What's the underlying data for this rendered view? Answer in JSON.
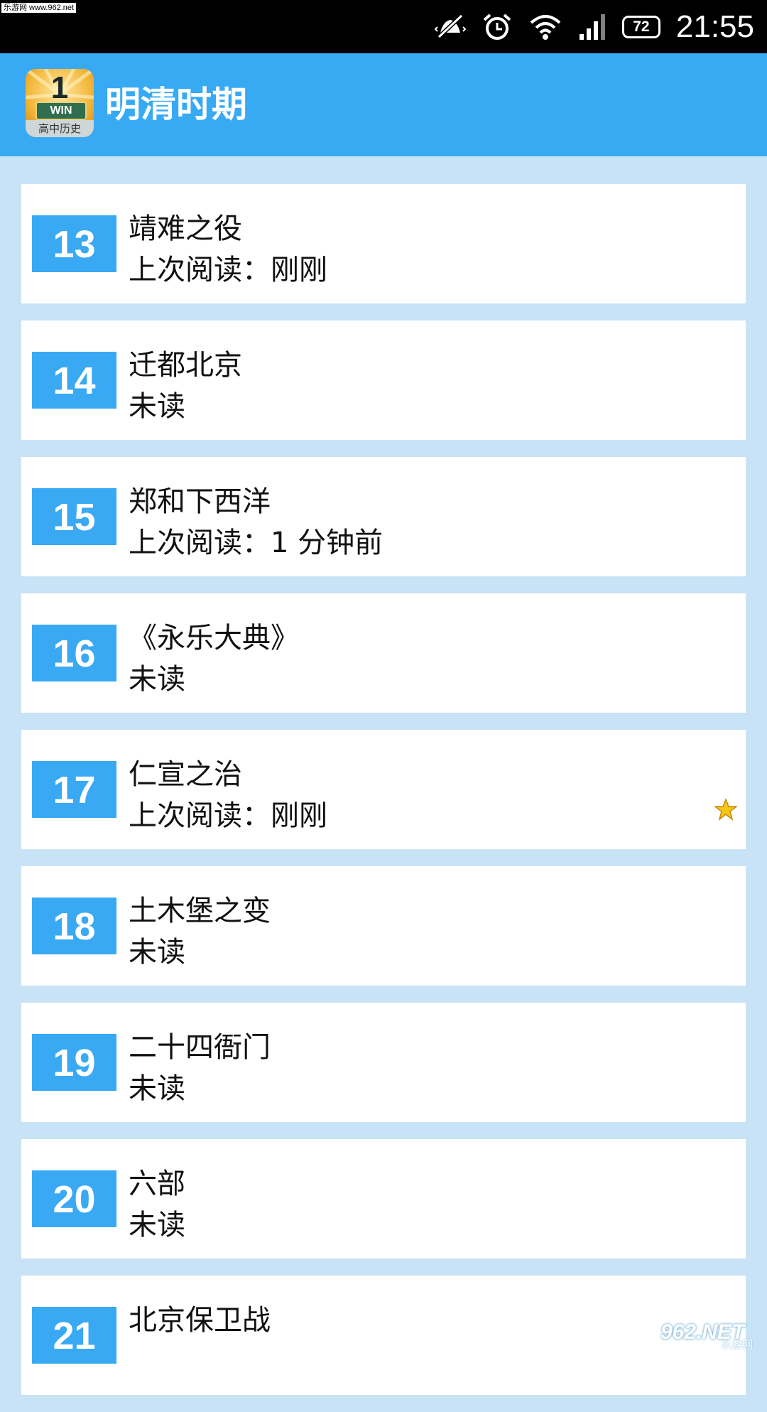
{
  "status_bar": {
    "watermark": "乐游网 www.962.net",
    "battery": "72",
    "time": "21:55",
    "icons": [
      "vibrate-off-icon",
      "alarm-icon",
      "wifi-icon",
      "signal-icon",
      "battery-icon"
    ]
  },
  "header": {
    "title": "明清时期",
    "logo": {
      "number": "1",
      "badge": "WIN",
      "subtitle": "高中历史"
    },
    "background": "#38aaf3"
  },
  "chapters": [
    {
      "number": "13",
      "title": "靖难之役",
      "status": "上次阅读：刚刚",
      "starred": false
    },
    {
      "number": "14",
      "title": "迁都北京",
      "status": "未读",
      "starred": false
    },
    {
      "number": "15",
      "title": "郑和下西洋",
      "status": "上次阅读：1 分钟前",
      "starred": false
    },
    {
      "number": "16",
      "title": "《永乐大典》",
      "status": "未读",
      "starred": false
    },
    {
      "number": "17",
      "title": "仁宣之治",
      "status": "上次阅读：刚刚",
      "starred": true
    },
    {
      "number": "18",
      "title": "土木堡之变",
      "status": "未读",
      "starred": false
    },
    {
      "number": "19",
      "title": "二十四衙门",
      "status": "未读",
      "starred": false
    },
    {
      "number": "20",
      "title": "六部",
      "status": "未读",
      "starred": false
    },
    {
      "number": "21",
      "title": "北京保卫战",
      "status": "",
      "starred": false
    }
  ],
  "colors": {
    "accent": "#39a9f4",
    "list_background": "#c9e3f6",
    "star": "#f5c518"
  },
  "watermark_bottom": {
    "main": "962.NET",
    "sub": "乐游网"
  }
}
